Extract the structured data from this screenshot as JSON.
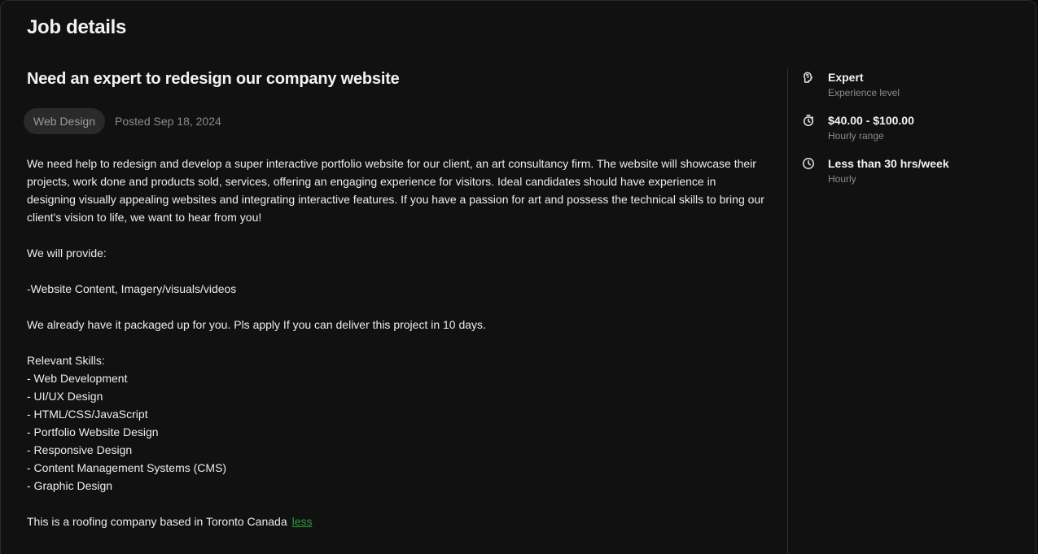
{
  "panel": {
    "title": "Job details"
  },
  "job": {
    "title": "Need an expert to redesign our company website",
    "tag": "Web Design",
    "posted": "Posted Sep 18, 2024",
    "description": {
      "intro": "We need help to redesign and develop a super interactive portfolio website for our client, an art consultancy firm. The website will showcase their projects, work done and products sold, services, offering an engaging experience for visitors. Ideal candidates should have experience in designing visually appealing websites and integrating interactive features. If you have a passion for art and possess the technical skills to bring our client's vision to life, we want to hear from you!",
      "provide_heading": "We will provide:",
      "provide_item": "-Website Content, Imagery/visuals/videos",
      "packaged": "We already have it packaged up for you. Pls apply If you can deliver this project in 10 days.",
      "skills_heading": "Relevant Skills:",
      "skills": [
        "- Web Development",
        "- UI/UX Design",
        "- HTML/CSS/JavaScript",
        "- Portfolio Website Design",
        "- Responsive Design",
        "- Content Management Systems (CMS)",
        "- Graphic Design"
      ],
      "closing": "This is a roofing company based in Toronto Canada",
      "less_label": "less"
    }
  },
  "sidebar": {
    "items": [
      {
        "value": "Expert",
        "label": "Experience level",
        "icon": "brain-icon"
      },
      {
        "value": "$40.00 - $100.00",
        "label": "Hourly range",
        "icon": "timer-icon"
      },
      {
        "value": "Less than 30 hrs/week",
        "label": "Hourly",
        "icon": "clock-icon"
      }
    ]
  },
  "colors": {
    "background": "#111111",
    "link": "#2e9b3d",
    "tag_bg": "#2a2a2a"
  }
}
